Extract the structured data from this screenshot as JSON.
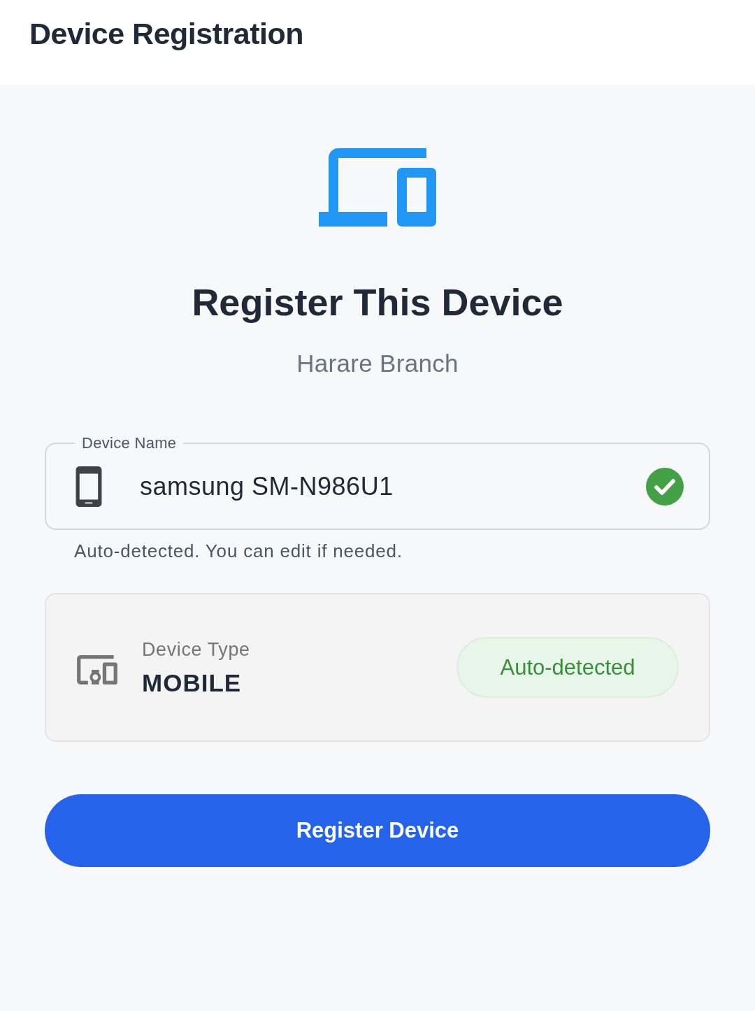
{
  "app_bar": {
    "title": "Device Registration"
  },
  "hero": {
    "title": "Register This Device",
    "subtitle": "Harare Branch"
  },
  "device_name": {
    "label": "Device Name",
    "value": "samsung SM-N986U1",
    "valid": true,
    "helper": "Auto-detected. You can edit if needed."
  },
  "device_type": {
    "label": "Device Type",
    "value": "MOBILE",
    "badge": "Auto-detected"
  },
  "button": {
    "label": "Register Device"
  }
}
